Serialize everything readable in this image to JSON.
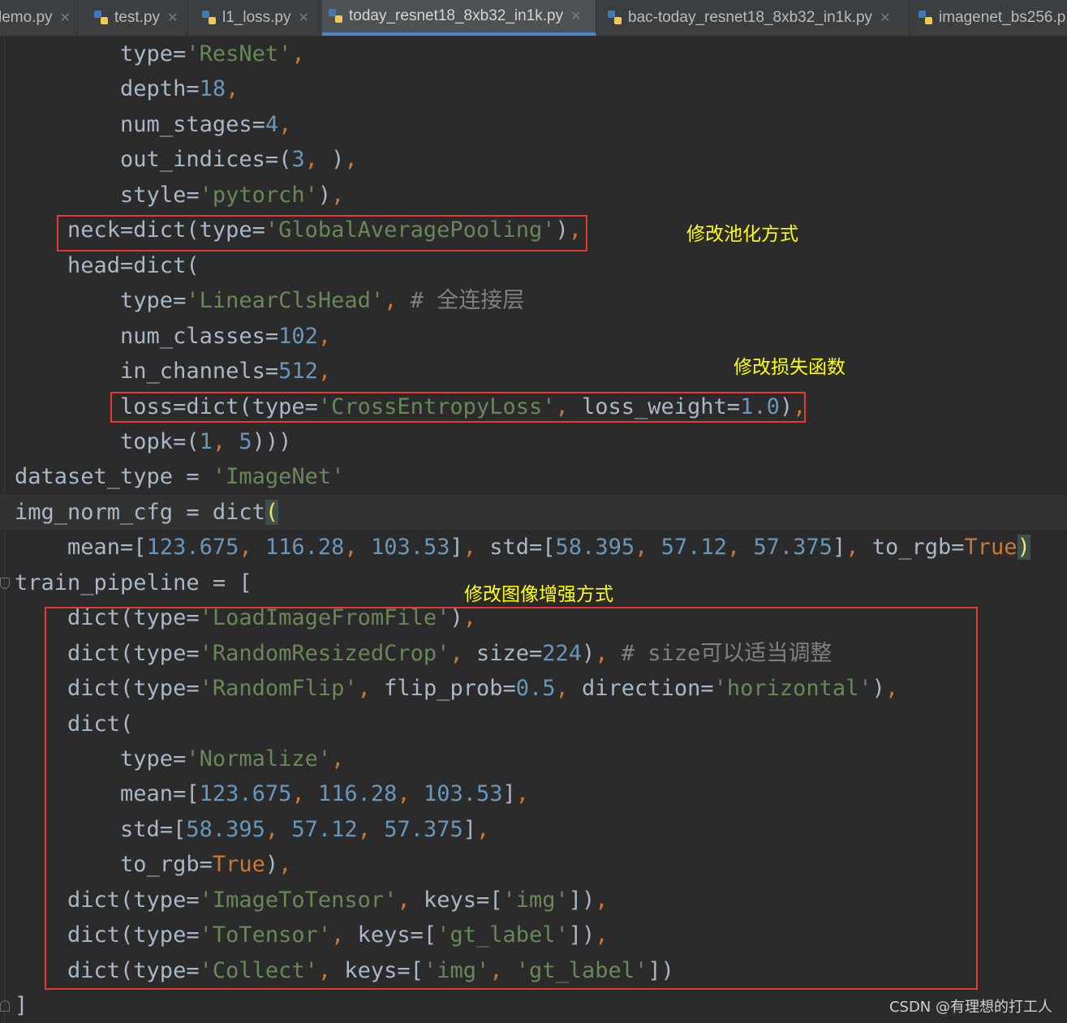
{
  "tabs": [
    {
      "label": "lemo.py"
    },
    {
      "label": "test.py"
    },
    {
      "label": "l1_loss.py"
    },
    {
      "label": "today_resnet18_8xb32_in1k.py"
    },
    {
      "label": "bac-today_resnet18_8xb32_in1k.py"
    },
    {
      "label": "imagenet_bs256.p"
    }
  ],
  "annotations": {
    "neck": "修改池化方式",
    "loss": "修改损失函数",
    "pipeline": "修改图像增强方式"
  },
  "watermark": "CSDN @有理想的打工人",
  "colors": {
    "editor_bg": "#2b2b2b",
    "string": "#6a8759",
    "number": "#6897bb",
    "keyword": "#cc7832",
    "comment": "#808080",
    "annotation": "#ffff00",
    "highlight_box": "#e53935"
  },
  "code_lines": [
    [
      {
        "t": "k",
        "v": "        type="
      },
      {
        "t": "s",
        "v": "'ResNet'"
      },
      {
        "t": "kw",
        "v": ","
      }
    ],
    [
      {
        "t": "k",
        "v": "        depth="
      },
      {
        "t": "n",
        "v": "18"
      },
      {
        "t": "kw",
        "v": ","
      }
    ],
    [
      {
        "t": "k",
        "v": "        num_stages="
      },
      {
        "t": "n",
        "v": "4"
      },
      {
        "t": "kw",
        "v": ","
      }
    ],
    [
      {
        "t": "k",
        "v": "        out_indices=("
      },
      {
        "t": "n",
        "v": "3"
      },
      {
        "t": "kw",
        "v": ", "
      },
      {
        "t": "k",
        "v": ")"
      },
      {
        "t": "kw",
        "v": ","
      }
    ],
    [
      {
        "t": "k",
        "v": "        style="
      },
      {
        "t": "s",
        "v": "'pytorch'"
      },
      {
        "t": "k",
        "v": ")"
      },
      {
        "t": "kw",
        "v": ","
      }
    ],
    [
      {
        "t": "k",
        "v": "    neck=dict(type="
      },
      {
        "t": "s",
        "v": "'GlobalAveragePooling'"
      },
      {
        "t": "k",
        "v": ")"
      },
      {
        "t": "kw",
        "v": ","
      }
    ],
    [
      {
        "t": "k",
        "v": "    head=dict("
      }
    ],
    [
      {
        "t": "k",
        "v": "        type="
      },
      {
        "t": "s",
        "v": "'LinearClsHead'"
      },
      {
        "t": "kw",
        "v": ", "
      },
      {
        "t": "c",
        "v": "# 全连接层"
      }
    ],
    [
      {
        "t": "k",
        "v": "        num_classes="
      },
      {
        "t": "n",
        "v": "102"
      },
      {
        "t": "kw",
        "v": ","
      }
    ],
    [
      {
        "t": "k",
        "v": "        in_channels="
      },
      {
        "t": "n",
        "v": "512"
      },
      {
        "t": "kw",
        "v": ","
      }
    ],
    [
      {
        "t": "k",
        "v": "        loss=dict(type="
      },
      {
        "t": "s",
        "v": "'CrossEntropyLoss'"
      },
      {
        "t": "kw",
        "v": ", "
      },
      {
        "t": "k",
        "v": "loss_weight="
      },
      {
        "t": "n",
        "v": "1.0"
      },
      {
        "t": "k",
        "v": ")"
      },
      {
        "t": "kw",
        "v": ","
      }
    ],
    [
      {
        "t": "k",
        "v": "        topk=("
      },
      {
        "t": "n",
        "v": "1"
      },
      {
        "t": "kw",
        "v": ", "
      },
      {
        "t": "n",
        "v": "5"
      },
      {
        "t": "k",
        "v": ")))"
      }
    ],
    [
      {
        "t": "k",
        "v": "dataset_type = "
      },
      {
        "t": "s",
        "v": "'ImageNet'"
      }
    ],
    [
      {
        "t": "k",
        "v": "img_norm_cfg = dict"
      },
      {
        "t": "brace",
        "v": "("
      }
    ],
    [
      {
        "t": "k",
        "v": "    mean=["
      },
      {
        "t": "n",
        "v": "123.675"
      },
      {
        "t": "kw",
        "v": ", "
      },
      {
        "t": "n",
        "v": "116.28"
      },
      {
        "t": "kw",
        "v": ", "
      },
      {
        "t": "n",
        "v": "103.53"
      },
      {
        "t": "k",
        "v": "]"
      },
      {
        "t": "kw",
        "v": ", "
      },
      {
        "t": "k",
        "v": "std=["
      },
      {
        "t": "n",
        "v": "58.395"
      },
      {
        "t": "kw",
        "v": ", "
      },
      {
        "t": "n",
        "v": "57.12"
      },
      {
        "t": "kw",
        "v": ", "
      },
      {
        "t": "n",
        "v": "57.375"
      },
      {
        "t": "k",
        "v": "]"
      },
      {
        "t": "kw",
        "v": ", "
      },
      {
        "t": "k",
        "v": "to_rgb="
      },
      {
        "t": "kw",
        "v": "True"
      },
      {
        "t": "brace",
        "v": ")"
      }
    ],
    [
      {
        "t": "k",
        "v": "train_pipeline = ["
      }
    ],
    [
      {
        "t": "k",
        "v": "    dict(type="
      },
      {
        "t": "s",
        "v": "'LoadImageFromFile'"
      },
      {
        "t": "k",
        "v": ")"
      },
      {
        "t": "kw",
        "v": ","
      }
    ],
    [
      {
        "t": "k",
        "v": "    dict(type="
      },
      {
        "t": "s",
        "v": "'RandomResizedCrop'"
      },
      {
        "t": "kw",
        "v": ", "
      },
      {
        "t": "k",
        "v": "size="
      },
      {
        "t": "n",
        "v": "224"
      },
      {
        "t": "k",
        "v": ")"
      },
      {
        "t": "kw",
        "v": ", "
      },
      {
        "t": "c",
        "v": "# size可以适当调整"
      }
    ],
    [
      {
        "t": "k",
        "v": "    dict(type="
      },
      {
        "t": "s",
        "v": "'RandomFlip'"
      },
      {
        "t": "kw",
        "v": ", "
      },
      {
        "t": "k",
        "v": "flip_prob="
      },
      {
        "t": "n",
        "v": "0.5"
      },
      {
        "t": "kw",
        "v": ", "
      },
      {
        "t": "k",
        "v": "direction="
      },
      {
        "t": "s",
        "v": "'horizontal'"
      },
      {
        "t": "k",
        "v": ")"
      },
      {
        "t": "kw",
        "v": ","
      }
    ],
    [
      {
        "t": "k",
        "v": "    dict("
      }
    ],
    [
      {
        "t": "k",
        "v": "        type="
      },
      {
        "t": "s",
        "v": "'Normalize'"
      },
      {
        "t": "kw",
        "v": ","
      }
    ],
    [
      {
        "t": "k",
        "v": "        mean=["
      },
      {
        "t": "n",
        "v": "123.675"
      },
      {
        "t": "kw",
        "v": ", "
      },
      {
        "t": "n",
        "v": "116.28"
      },
      {
        "t": "kw",
        "v": ", "
      },
      {
        "t": "n",
        "v": "103.53"
      },
      {
        "t": "k",
        "v": "]"
      },
      {
        "t": "kw",
        "v": ","
      }
    ],
    [
      {
        "t": "k",
        "v": "        std=["
      },
      {
        "t": "n",
        "v": "58.395"
      },
      {
        "t": "kw",
        "v": ", "
      },
      {
        "t": "n",
        "v": "57.12"
      },
      {
        "t": "kw",
        "v": ", "
      },
      {
        "t": "n",
        "v": "57.375"
      },
      {
        "t": "k",
        "v": "]"
      },
      {
        "t": "kw",
        "v": ","
      }
    ],
    [
      {
        "t": "k",
        "v": "        to_rgb="
      },
      {
        "t": "kw",
        "v": "True"
      },
      {
        "t": "k",
        "v": ")"
      },
      {
        "t": "kw",
        "v": ","
      }
    ],
    [
      {
        "t": "k",
        "v": "    dict(type="
      },
      {
        "t": "s",
        "v": "'ImageToTensor'"
      },
      {
        "t": "kw",
        "v": ", "
      },
      {
        "t": "k",
        "v": "keys=["
      },
      {
        "t": "s",
        "v": "'img'"
      },
      {
        "t": "k",
        "v": "])"
      },
      {
        "t": "kw",
        "v": ","
      }
    ],
    [
      {
        "t": "k",
        "v": "    dict(type="
      },
      {
        "t": "s",
        "v": "'ToTensor'"
      },
      {
        "t": "kw",
        "v": ", "
      },
      {
        "t": "k",
        "v": "keys=["
      },
      {
        "t": "s",
        "v": "'gt_label'"
      },
      {
        "t": "k",
        "v": "])"
      },
      {
        "t": "kw",
        "v": ","
      }
    ],
    [
      {
        "t": "k",
        "v": "    dict(type="
      },
      {
        "t": "s",
        "v": "'Collect'"
      },
      {
        "t": "kw",
        "v": ", "
      },
      {
        "t": "k",
        "v": "keys=["
      },
      {
        "t": "s",
        "v": "'img'"
      },
      {
        "t": "kw",
        "v": ", "
      },
      {
        "t": "s",
        "v": "'gt_label'"
      },
      {
        "t": "k",
        "v": "])"
      }
    ],
    [
      {
        "t": "k",
        "v": "]"
      }
    ]
  ]
}
